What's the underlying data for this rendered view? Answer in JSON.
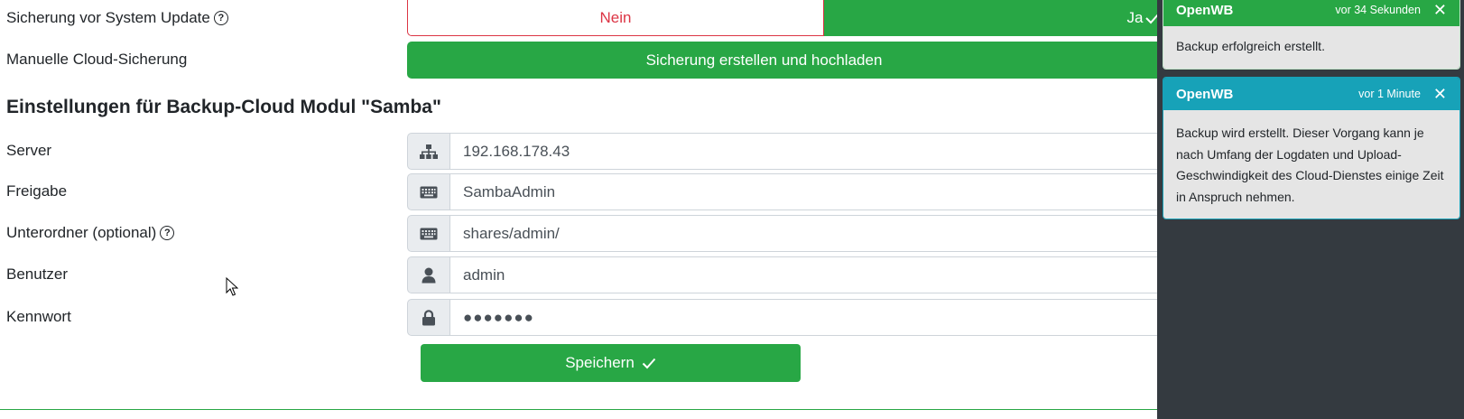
{
  "form": {
    "backup_before_update_label": "Sicherung vor System Update",
    "option_no": "Nein",
    "option_yes": "Ja",
    "manual_cloud_label": "Manuelle Cloud-Sicherung",
    "manual_cloud_button": "Sicherung erstellen und hochladen",
    "section_heading": "Einstellungen für Backup-Cloud Modul \"Samba\"",
    "fields": [
      {
        "label": "Server",
        "value": "192.168.178.43",
        "icon": "network-icon"
      },
      {
        "label": "Freigabe",
        "value": "SambaAdmin",
        "icon": "keyboard-icon"
      },
      {
        "label": "Unterordner (optional)",
        "value": "shares/admin/",
        "icon": "keyboard-icon"
      },
      {
        "label": "Benutzer",
        "value": "admin",
        "icon": "user-icon"
      },
      {
        "label": "Kennwort",
        "value": "●●●●●●●",
        "icon": "lock-icon"
      }
    ],
    "save_button": "Speichern"
  },
  "notifications": [
    {
      "title": "OpenWB",
      "time": "vor 34 Sekunden",
      "message": "Backup erfolgreich erstellt.",
      "header_color": "#28a745"
    },
    {
      "title": "OpenWB",
      "time": "vor 1 Minute",
      "message": "Backup wird erstellt. Dieser Vorgang kann je nach Umfang der Logdaten und Upload-Geschwindigkeit des Cloud-Dienstes einige Zeit in Anspruch nehmen.",
      "header_color": "#17a2b8"
    }
  ],
  "colors": {
    "success": "#28a745",
    "danger": "#dc3545",
    "info": "#17a2b8",
    "panel_bg": "#343a40"
  }
}
